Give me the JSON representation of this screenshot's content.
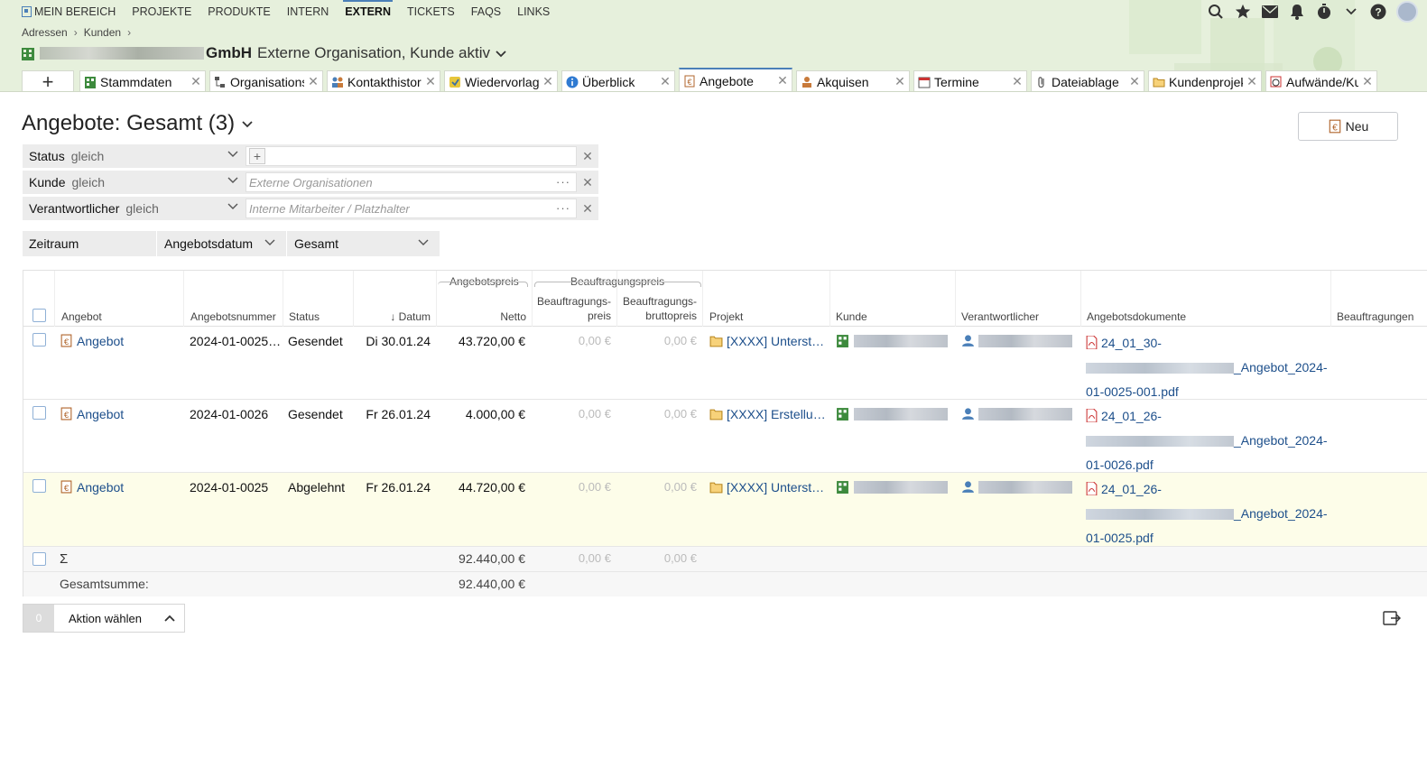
{
  "topnav": [
    "MEIN BEREICH",
    "PROJEKTE",
    "PRODUKTE",
    "INTERN",
    "EXTERN",
    "TICKETS",
    "FAQS",
    "LINKS"
  ],
  "topnav_active": "EXTERN",
  "breadcrumb": [
    "Adressen",
    "Kunden"
  ],
  "org": {
    "name_tail": "GmbH",
    "subtitle": "Externe Organisation, Kunde aktiv"
  },
  "tabs": [
    {
      "label": "Stammdaten",
      "icon": "building-icon"
    },
    {
      "label": "Organisationsstruktur",
      "icon": "org-tree-icon"
    },
    {
      "label": "Kontakthistorie",
      "icon": "contacts-icon"
    },
    {
      "label": "Wiedervorlagen",
      "icon": "followup-icon"
    },
    {
      "label": "Überblick",
      "icon": "info-icon"
    },
    {
      "label": "Angebote",
      "icon": "offer-icon"
    },
    {
      "label": "Akquisen",
      "icon": "acquisition-icon"
    },
    {
      "label": "Termine",
      "icon": "calendar-icon"
    },
    {
      "label": "Dateiablage",
      "icon": "paperclip-icon"
    },
    {
      "label": "Kundenprojekte",
      "icon": "folder-icon"
    },
    {
      "label": "Aufwände/Kunde",
      "icon": "effort-icon"
    }
  ],
  "active_tab": "Angebote",
  "page_title": "Angebote: Gesamt (3)",
  "new_button": "Neu",
  "filters": [
    {
      "label": "Status",
      "op": "gleich",
      "placeholder": "",
      "has_plus": true
    },
    {
      "label": "Kunde",
      "op": "gleich",
      "placeholder": "Externe Organisationen",
      "has_plus": false
    },
    {
      "label": "Verantwortlicher",
      "op": "gleich",
      "placeholder": "Interne Mitarbeiter / Platzhalter",
      "has_plus": false
    }
  ],
  "period": {
    "label": "Zeitraum",
    "field": "Angebotsdatum",
    "value": "Gesamt"
  },
  "table": {
    "group_headers": {
      "angebotspreis": "Angebotspreis",
      "beauftragungspreis": "Beauftragungspreis"
    },
    "columns": {
      "angebot": "Angebot",
      "nummer": "Angebotsnummer",
      "status": "Status",
      "datum": "Datum",
      "netto": "Netto",
      "bpreis_1": "Beauftragungs-",
      "bpreis_2": "preis",
      "bbrutto_1": "Beauftragungs-",
      "bbrutto_2": "bruttopreis",
      "projekt": "Projekt",
      "kunde": "Kunde",
      "verantwortlicher": "Verantwortlicher",
      "dokumente": "Angebotsdokumente",
      "beauftragungen": "Beauftragungen"
    },
    "rows": [
      {
        "angebot": "Angebot",
        "nummer": "2024-01-0025…",
        "status": "Gesendet",
        "datum": "Di 30.01.24",
        "netto": "43.720,00 €",
        "bpreis": "0,00 €",
        "bbrutto": "0,00 €",
        "projekt": "[XXXX] Unterst…",
        "doc_line1": "24_01_30-",
        "doc_line2_tail": "_Angebot_2024-",
        "doc_line3": "01-0025-001.pdf"
      },
      {
        "angebot": "Angebot",
        "nummer": "2024-01-0026",
        "status": "Gesendet",
        "datum": "Fr 26.01.24",
        "netto": "4.000,00 €",
        "bpreis": "0,00 €",
        "bbrutto": "0,00 €",
        "projekt": "[XXXX] Erstellu…",
        "doc_line1": "24_01_26-",
        "doc_line2_tail": "_Angebot_2024-",
        "doc_line3": "01-0026.pdf"
      },
      {
        "angebot": "Angebot",
        "nummer": "2024-01-0025",
        "status": "Abgelehnt",
        "datum": "Fr 26.01.24",
        "netto": "44.720,00 €",
        "bpreis": "0,00 €",
        "bbrutto": "0,00 €",
        "projekt": "[XXXX] Unterst…",
        "doc_line1": "24_01_26-",
        "doc_line2_tail": "_Angebot_2024-",
        "doc_line3": "01-0025.pdf"
      }
    ],
    "sum_row": {
      "symbol": "Σ",
      "netto": "92.440,00 €",
      "bpreis": "0,00 €",
      "bbrutto": "0,00 €"
    },
    "total_row": {
      "label": "Gesamtsumme:",
      "netto": "92.440,00 €"
    }
  },
  "action": {
    "count": "0",
    "label": "Aktion wählen"
  },
  "colors": {
    "accent": "#4a7fb8",
    "link": "#1d4f8b",
    "header_bg": "#e6f0dc",
    "highlight_row": "#fdfde9"
  }
}
